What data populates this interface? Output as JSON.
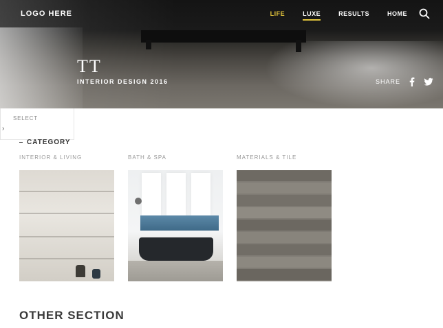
{
  "header": {
    "logo": "LOGO HERE",
    "nav": [
      {
        "label": "LIFE",
        "accent": true,
        "active": false
      },
      {
        "label": "LUXE",
        "accent": false,
        "active": true
      },
      {
        "label": "RESULTS",
        "accent": false,
        "active": false
      },
      {
        "label": "HOME",
        "accent": false,
        "active": false
      }
    ],
    "search_icon": "search-icon"
  },
  "hero": {
    "title": "TT",
    "subtitle": "INTERIOR DESIGN 2016",
    "share_label": "SHARE",
    "share_icons": [
      "facebook-icon",
      "twitter-icon"
    ]
  },
  "dropdown": {
    "label": "SELECT"
  },
  "section": {
    "label": "CATEGORY"
  },
  "cards": [
    {
      "caption": "INTERIOR & LIVING",
      "image": "shelving-wall-image"
    },
    {
      "caption": "BATH & SPA",
      "image": "bathtub-window-image"
    },
    {
      "caption": "MATERIALS & TILE",
      "image": "stone-tiles-image"
    }
  ],
  "other_section": {
    "title": "OTHER SECTION"
  },
  "colors": {
    "accent": "#e2c43c",
    "nav_text": "#ffffff"
  }
}
